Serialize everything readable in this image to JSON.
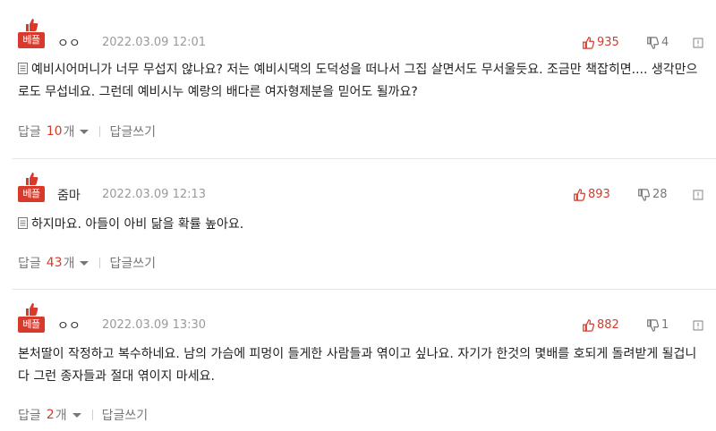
{
  "best_label": "베플",
  "reply_label": "답글",
  "count_suffix": "개",
  "write_label": "답글쓰기",
  "colors": {
    "accent": "#d8392b",
    "muted": "#9a9a9a"
  },
  "comments": [
    {
      "author": "ㅇㅇ",
      "date": "2022.03.09 12:01",
      "likes": "935",
      "dislikes": "4",
      "text": "예비시어머니가 너무 무섭지 않나요? 저는 예비시댁의 도덕성을 떠나서 그집 살면서도 무서울듯요. 조금만 책잡히면.... 생각만으로도 무섭네요. 그런데 예비시누 예랑의 배다른 여자형제분을 믿어도 될까요?",
      "replies": "10"
    },
    {
      "author": "줌마",
      "date": "2022.03.09 12:13",
      "likes": "893",
      "dislikes": "28",
      "text": "하지마요. 아들이 아비 닮을 확률 높아요.",
      "replies": "43"
    },
    {
      "author": "ㅇㅇ",
      "date": "2022.03.09 13:30",
      "likes": "882",
      "dislikes": "1",
      "text": "본처딸이 작정하고 복수하네요. 남의 가슴에 피멍이 들게한 사람들과 엮이고 싶나요. 자기가 한것의 몇배를 호되게 돌려받게 될겁니다 그런 종자들과 절대 엮이지 마세요.",
      "replies": "2"
    }
  ]
}
